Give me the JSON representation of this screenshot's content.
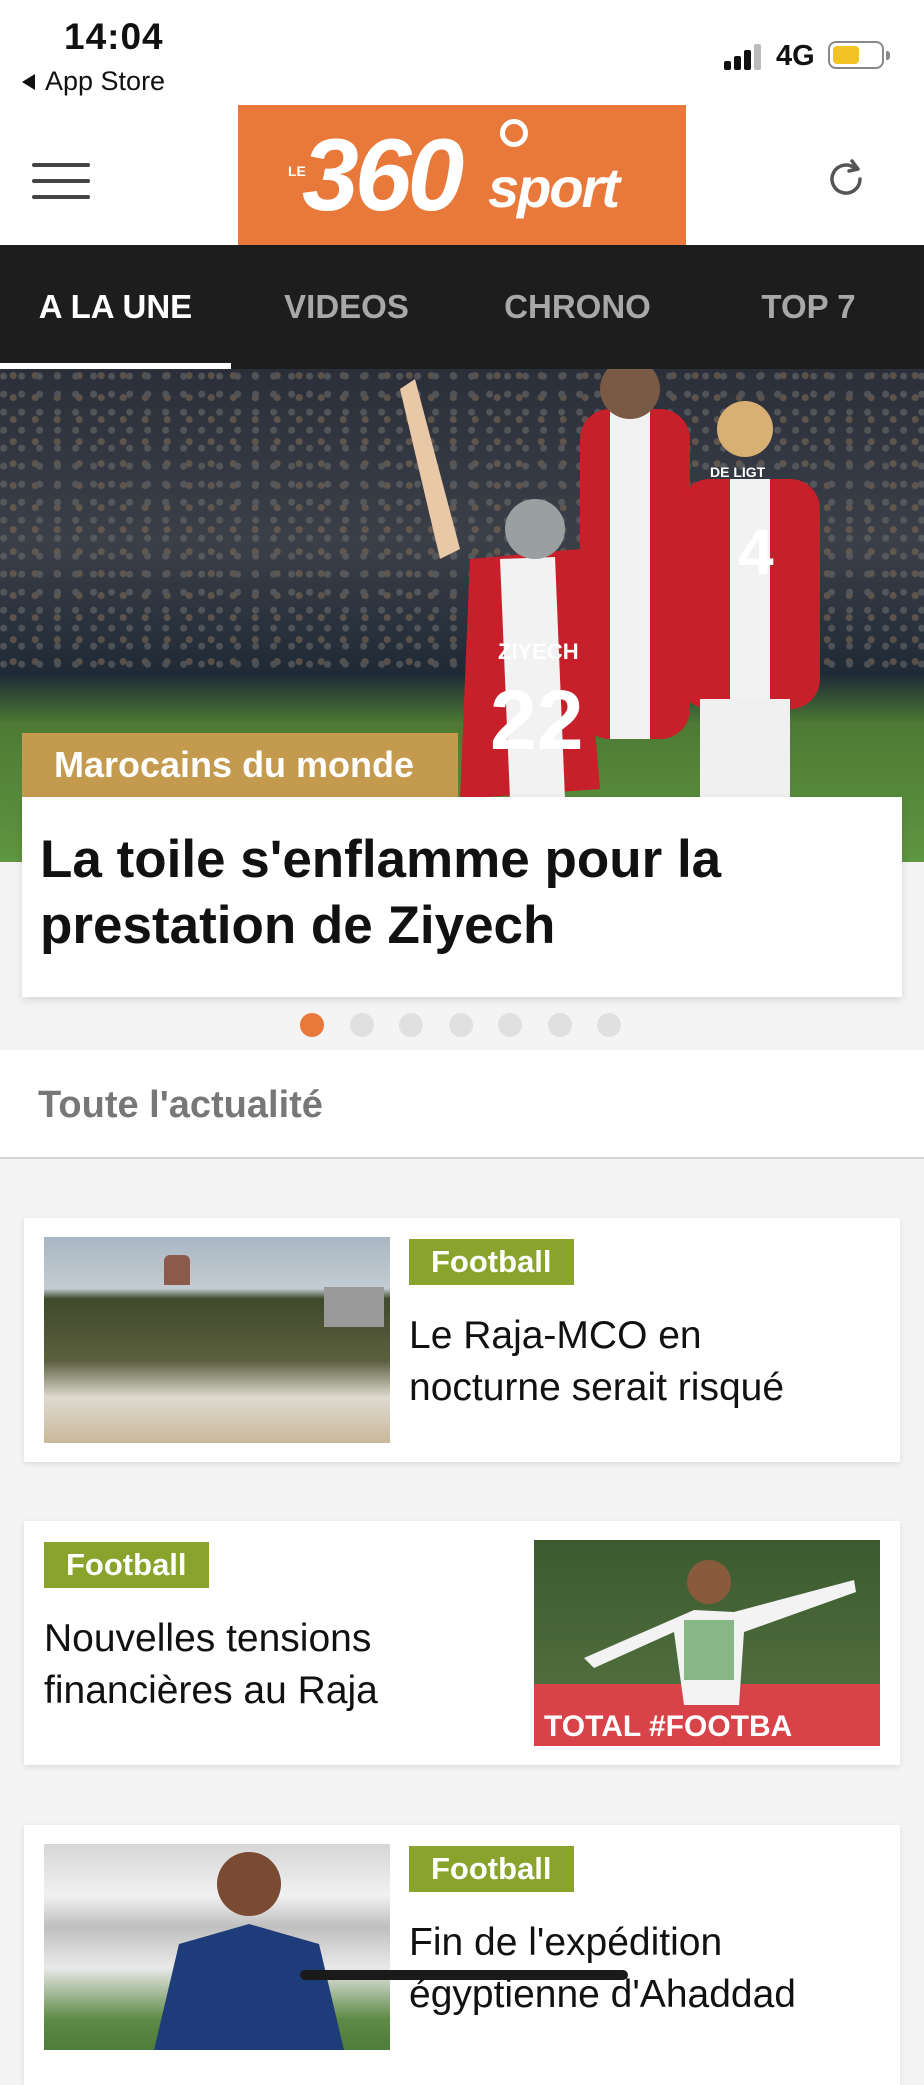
{
  "status_bar": {
    "time": "14:04",
    "back_label": "App Store",
    "network": "4G"
  },
  "header": {
    "logo_prefix": "LE",
    "logo_number": "360",
    "logo_suffix": "sport"
  },
  "tabs": [
    {
      "label": "A LA UNE",
      "active": true
    },
    {
      "label": "VIDEOS",
      "active": false
    },
    {
      "label": "CHRONO",
      "active": false
    },
    {
      "label": "TOP 7",
      "active": false
    }
  ],
  "hero": {
    "category": "Marocains du monde",
    "title": "La toile s'enflamme pour la prestation de Ziyech",
    "jersey_name": "ZIYECH",
    "jersey_number": "22",
    "jersey_name_2": "DE LIGT",
    "jersey_number_2": "4",
    "carousel_count": 7,
    "carousel_active": 1
  },
  "section": {
    "label": "Toute l'actualité"
  },
  "articles": [
    {
      "category": "Football",
      "title": "Le Raja-MCO en nocturne serait risqué"
    },
    {
      "category": "Football",
      "title": "Nouvelles tensions financières au Raja",
      "banner_text": "TOTAL #FOOTBA"
    },
    {
      "category": "Football",
      "title": "Fin de l'expédition égyptienne d'Ahaddad"
    }
  ],
  "colors": {
    "brand_orange": "#e8793a",
    "category_gold": "#c49a4e",
    "category_green": "#8aa32d",
    "tab_bar": "#1d1d1d"
  }
}
